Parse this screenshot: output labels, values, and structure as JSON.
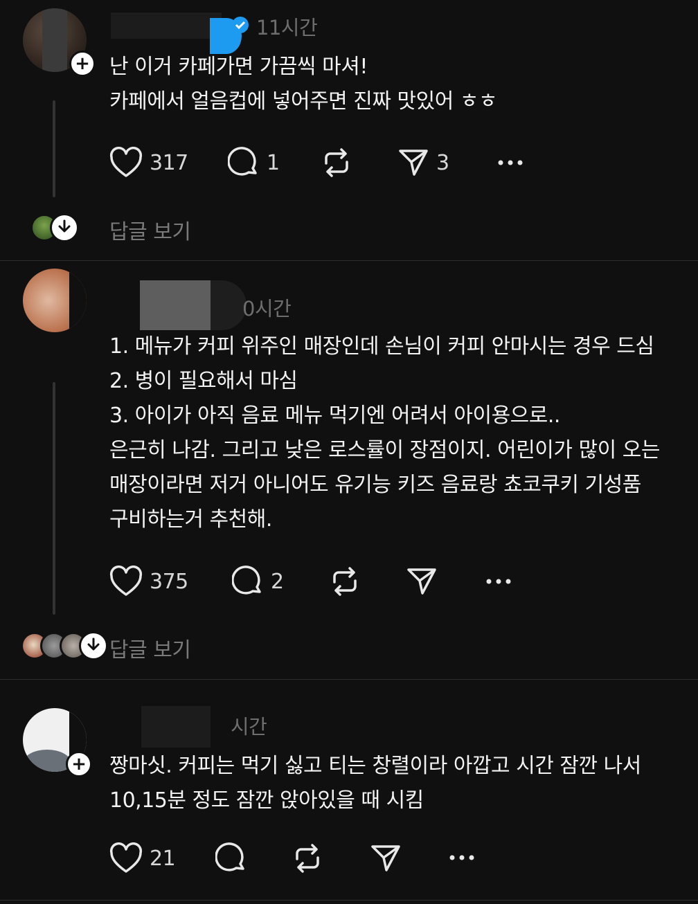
{
  "posts": [
    {
      "time": "11시간",
      "lines": [
        "난 이거 카페가면 가끔씩 마셔!",
        "카페에서 얼음컵에 넣어주면 진짜 맛있어 ㅎㅎ"
      ],
      "likes": "317",
      "comments": "1",
      "reposts": "",
      "shares": "3",
      "view_replies": "답글 보기"
    },
    {
      "time": "0시간",
      "lines": [
        "1. 메뉴가 커피 위주인 매장인데 손님이 커피 안마시는 경우 드심",
        "2. 병이 필요해서 마심",
        "3. 아이가 아직 음료 메뉴 먹기엔 어려서 아이용으로..",
        "은근히 나감. 그리고 낮은 로스률이 장점이지. 어린이가 많이 오는",
        "매장이라면 저거 아니어도 유기능 키즈 음료랑 쵸코쿠키 기성품",
        "구비하는거 추천해."
      ],
      "likes": "375",
      "comments": "2",
      "reposts": "",
      "shares": "",
      "view_replies": "답글 보기"
    },
    {
      "time": "시간",
      "lines": [
        "짱마싯. 커피는 먹기 싫고 티는 창렬이라 아깝고 시간 잠깐 나서",
        "10,15분 정도 잠깐 앉아있을 때 시킴"
      ],
      "likes": "21",
      "comments": "",
      "reposts": "",
      "shares": "",
      "view_replies": ""
    }
  ],
  "icons": {
    "like": "heart-icon",
    "comment": "speech-bubble-icon",
    "repost": "repost-arrows-icon",
    "share": "paper-plane-icon",
    "more": "more-dots-icon",
    "verified": "verified-badge-icon",
    "follow": "plus-icon",
    "expand": "arrow-down-icon"
  },
  "colors": {
    "background": "#101010",
    "text": "#f3f3f3",
    "muted": "#7a7a7a",
    "verified": "#1d9bf0"
  }
}
